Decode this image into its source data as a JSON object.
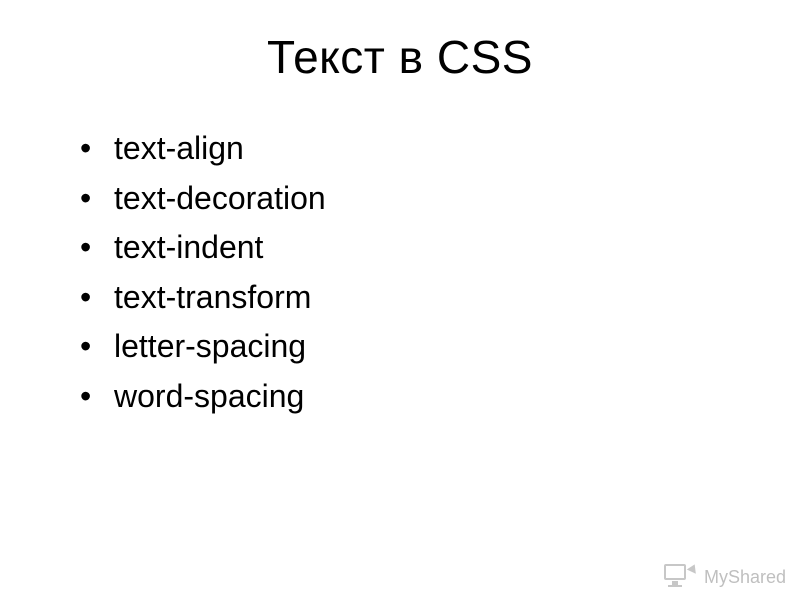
{
  "title": "Текст в CSS",
  "bullets": [
    "text-align",
    "text-decoration",
    "text-indent",
    "text-transform",
    "letter-spacing",
    "word-spacing"
  ],
  "watermark": "MyShared"
}
